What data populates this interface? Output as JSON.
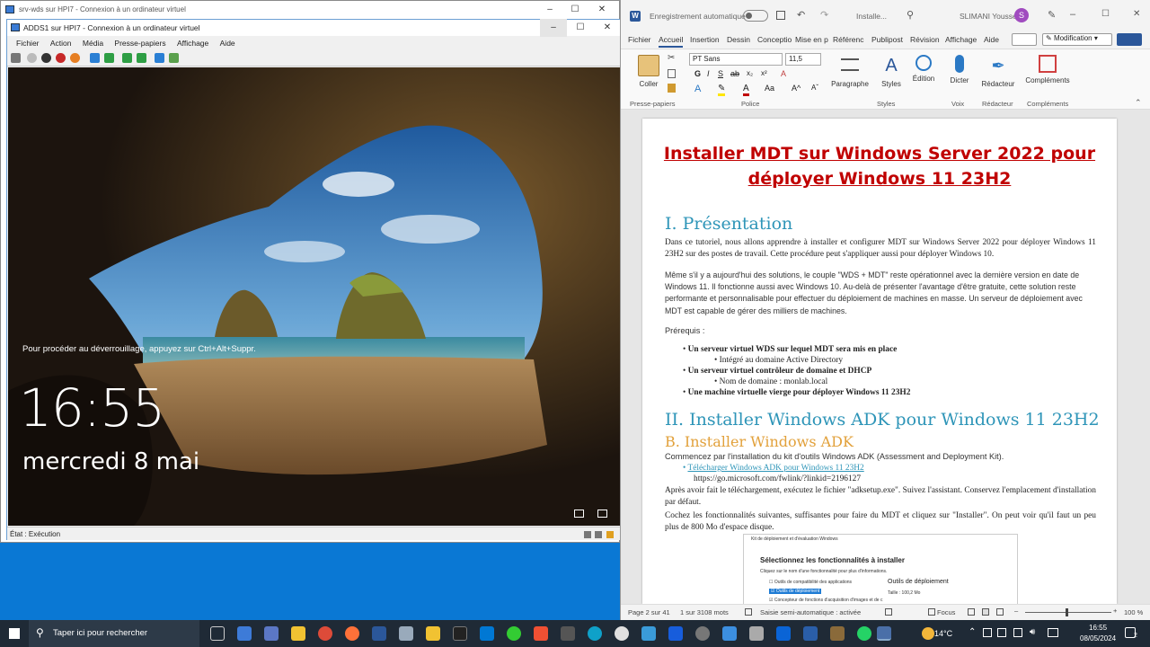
{
  "outer_window": {
    "title": "srv-wds sur HPI7 - Connexion à un ordinateur virtuel"
  },
  "inner_window": {
    "title": "ADDS1 sur HPI7 - Connexion à un ordinateur virtuel",
    "menu": [
      "Fichier",
      "Action",
      "Média",
      "Presse-papiers",
      "Affichage",
      "Aide"
    ],
    "status": "État : Exécution"
  },
  "lockscreen": {
    "unlock_hint": "Pour procéder au déverrouillage, appuyez sur Ctrl+Alt+Suppr.",
    "time": "16:55",
    "date": "mercredi 8 mai"
  },
  "word": {
    "autosave_label": "Enregistrement automatique",
    "doc_name": "Installe...",
    "user": "SLIMANI Youssef",
    "user_initial": "S",
    "tabs": [
      "Fichier",
      "Accueil",
      "Insertion",
      "Dessin",
      "Conceptio",
      "Mise en p",
      "Référenc",
      "Publipost",
      "Révision",
      "Affichage",
      "Aide"
    ],
    "modification_label": "Modification",
    "ribbon": {
      "paste_label": "Coller",
      "clipboard_group": "Presse-papiers",
      "font_name": "PT Sans",
      "font_size": "11,5",
      "font_group": "Police",
      "paragraph_label": "Paragraphe",
      "styles_label": "Styles",
      "styles_group": "Styles",
      "edit_label": "Édition",
      "dictate_label": "Dicter",
      "voice_group": "Voix",
      "editor_label": "Rédacteur",
      "editor_group": "Rédacteur",
      "addins_label": "Compléments",
      "addins_group": "Compléments"
    },
    "document": {
      "title_line1": "Installer MDT sur Windows Server 2022 pour",
      "title_line2": "déployer Windows 11 23H2",
      "h1_presentation": "I. Présentation",
      "p1": "Dans ce tutoriel, nous allons apprendre à installer et configurer MDT sur Windows Server 2022 pour déployer Windows 11 23H2 sur des postes de travail. Cette procédure peut s'appliquer aussi pour déployer Windows 10.",
      "p2": "Même s'il y a aujourd'hui des solutions, le couple \"WDS + MDT\" reste opérationnel avec la dernière version en date de Windows 11. Il fonctionne aussi avec Windows 10. Au-delà de présenter l'avantage d'être gratuite, cette solution reste performante et personnalisable pour effectuer du déploiement de machines en masse. Un serveur de déploiement avec MDT est capable de gérer des milliers de machines.",
      "prereq_label": "Prérequis :",
      "prereq_items": [
        "Un serveur virtuel WDS sur lequel MDT sera mis en place",
        "Intégré au domaine Active Directory",
        "Un serveur virtuel contrôleur de domaine et DHCP",
        "Nom de domaine : monlab.local",
        "Une machine virtuelle vierge pour déployer Windows 11 23H2"
      ],
      "h1_adk": "II. Installer Windows ADK pour Windows 11 23H2",
      "h2_adk": "B. Installer Windows ADK",
      "p3": "Commencez par l'installation du kit d'outils Windows ADK (Assessment and Deployment Kit).",
      "link": "Télécharger Windows ADK pour Windows 11 23H2",
      "url": "https://go.microsoft.com/fwlink/?linkid=2196127",
      "p4": "Après avoir fait le téléchargement, exécutez le fichier \"adksetup.exe\". Suivez l'assistant. Conservez l'emplacement d'installation par défaut.",
      "p5": "Cochez les fonctionnalités suivantes, suffisantes pour faire du MDT et cliquez sur \"Installer\". On peut voir qu'il faut un peu plus de 800 Mo d'espace disque.",
      "embed_title": "Kit de déploiement et d'évaluation Windows",
      "embed_heading": "Sélectionnez les fonctionnalités à installer",
      "embed_sub": "Cliquez sur le nom d'une fonctionnalité pour plus d'informations.",
      "embed_item1": "Outils de compatibilité des applications",
      "embed_item2": "Outils de déploiement",
      "embed_item3": "Concepteur de fonctions d'acquisition d'images et de c",
      "embed_right_title": "Outils de déploiement",
      "embed_right_size": "Taille : 100,2 Mo"
    },
    "status": {
      "page": "Page 2 sur 41",
      "words": "1 sur 3108 mots",
      "input": "Saisie semi-automatique : activée",
      "focus": "Focus",
      "zoom": "100 %"
    }
  },
  "taskbar": {
    "search_placeholder": "Taper ici pour rechercher",
    "temperature": "14°C",
    "time": "16:55",
    "date": "08/05/2024",
    "notif_count": "2"
  },
  "colors": {
    "accent": "#2b579a",
    "title_red": "#c00000",
    "heading_blue": "#2e95b8",
    "heading_orange": "#e2a13b",
    "desktop": "#0a78d4"
  }
}
